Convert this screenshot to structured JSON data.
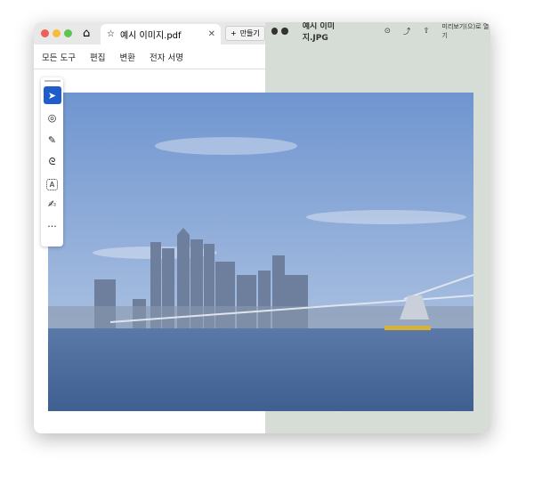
{
  "left_window": {
    "tab_title": "예시 이미지.pdf",
    "create_label": "만들기",
    "menu": [
      "모든 도구",
      "편집",
      "변환",
      "전자 서명"
    ],
    "tools": [
      "select-icon",
      "comment-icon",
      "pen-icon",
      "lasso-icon",
      "text-select-icon",
      "sign-icon",
      "more-icon"
    ],
    "more_label": "···"
  },
  "right_window": {
    "title": "예시 이미지.JPG",
    "open_preview_label": "미리보기(으)로 열기"
  },
  "colors": {
    "accent": "#1f5ccc",
    "right_bg": "#d6dcd6"
  }
}
